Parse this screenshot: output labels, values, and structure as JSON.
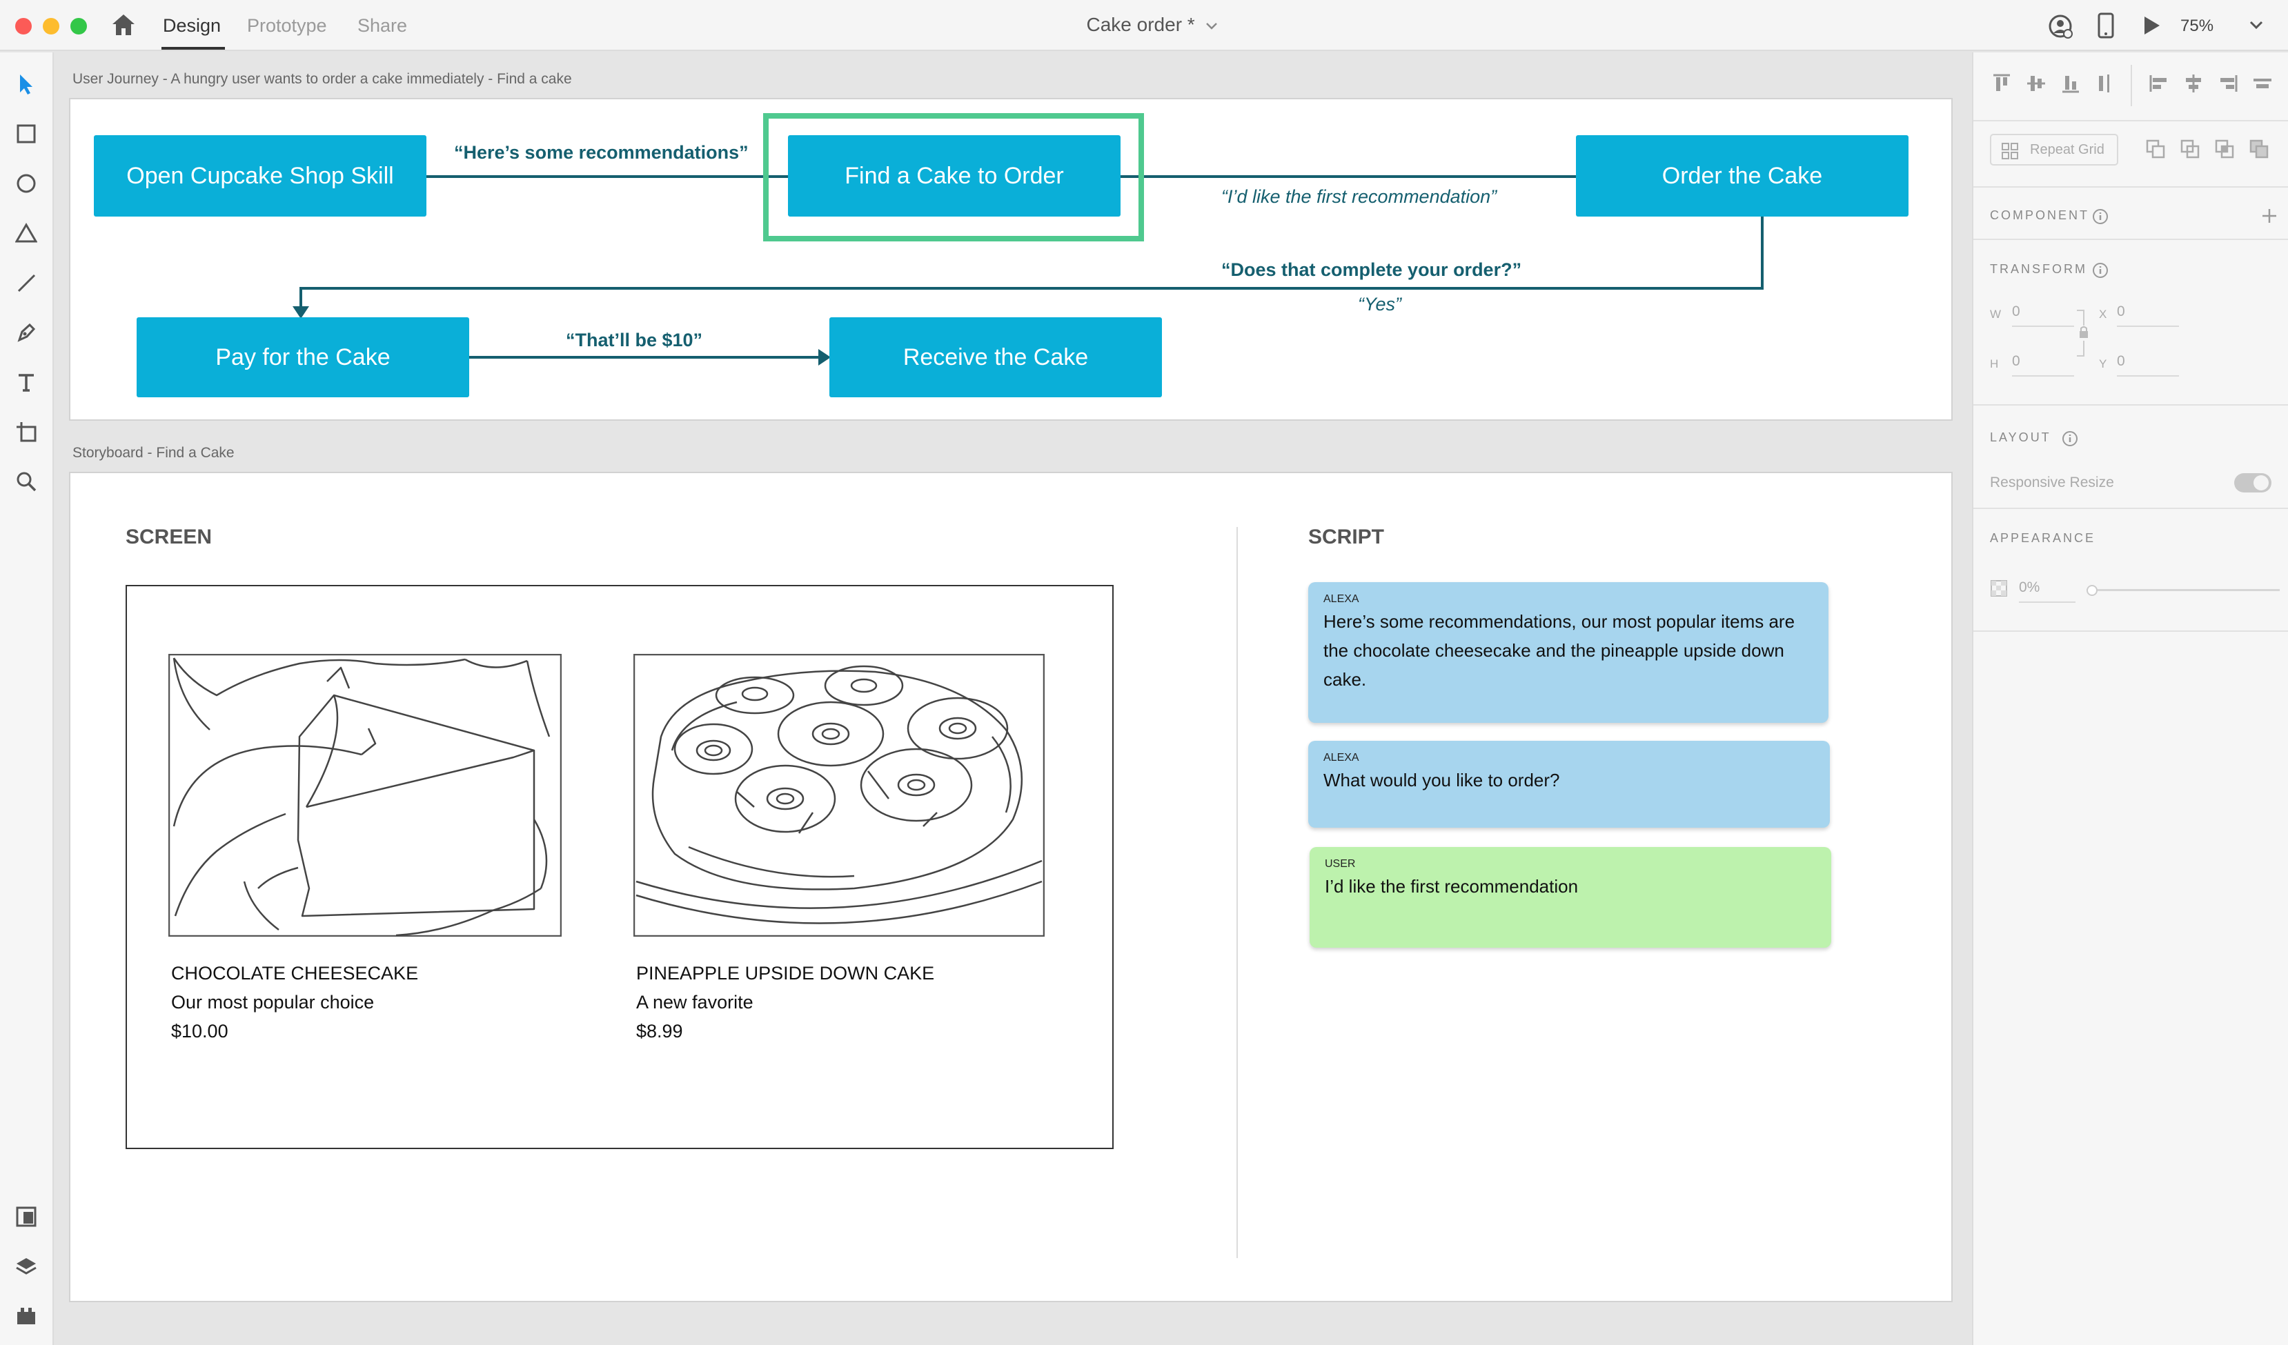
{
  "window": {
    "title": "Cake order *",
    "tabs": [
      "Design",
      "Prototype",
      "Share"
    ],
    "active_tab": "Design",
    "zoom": "75%"
  },
  "colors": {
    "flow_box": "#0aafd8",
    "flow_text": "#155f6f",
    "highlight": "#4fc98f",
    "alexa_bubble": "#a7d5ee",
    "user_bubble": "#bdf2ad"
  },
  "journey": {
    "label": "User Journey - A hungry user wants to order a cake immediately - Find a cake",
    "steps": [
      "Open Cupcake Shop Skill",
      "Find a Cake to Order",
      "Order the Cake",
      "Pay for the Cake",
      "Receive the Cake"
    ],
    "arrow_labels": [
      "“Here’s some recommendations”",
      "“I’d like the first recommendation”",
      "“Does that complete your order?”",
      "“Yes”",
      "“That’ll be $10”"
    ]
  },
  "storyboard": {
    "label": "Storyboard - Find a Cake",
    "screen_heading": "SCREEN",
    "script_heading": "SCRIPT",
    "cakes": [
      {
        "name": "CHOCOLATE CHEESECAKE",
        "tagline": "Our most popular choice",
        "price": "$10.00"
      },
      {
        "name": "PINEAPPLE UPSIDE DOWN CAKE",
        "tagline": "A new favorite",
        "price": "$8.99"
      }
    ],
    "script": [
      {
        "speaker": "ALEXA",
        "text": "Here’s some recommendations, our most popular items are the chocolate cheesecake and the pineapple upside down cake."
      },
      {
        "speaker": "ALEXA",
        "text": "What would you like to order?"
      },
      {
        "speaker": "USER",
        "text": "I’d like the first recommendation"
      }
    ]
  },
  "panel": {
    "repeat_grid": "Repeat Grid",
    "component": "COMPONENT",
    "transform": "TRANSFORM",
    "w_label": "W",
    "w_value": "0",
    "x_label": "X",
    "x_value": "0",
    "h_label": "H",
    "h_value": "0",
    "y_label": "Y",
    "y_value": "0",
    "layout": "LAYOUT",
    "responsive_resize": "Responsive Resize",
    "appearance": "APPEARANCE",
    "opacity": "0%"
  },
  "icons": [
    "home-icon",
    "select-icon",
    "rectangle-icon",
    "ellipse-icon",
    "triangle-icon",
    "line-icon",
    "pen-icon",
    "text-icon",
    "artboard-icon",
    "zoom-icon",
    "assets-icon",
    "layers-icon",
    "plugins-icon",
    "user-icon",
    "device-icon",
    "play-icon"
  ]
}
